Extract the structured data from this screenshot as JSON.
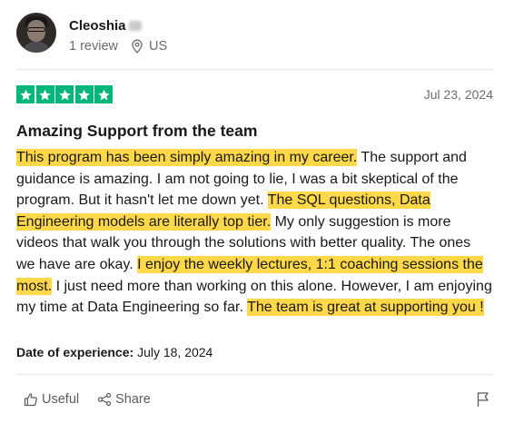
{
  "reviewer": {
    "name": "Cleoshia",
    "reviews_count": "1 review",
    "country": "US"
  },
  "review": {
    "rating": 5,
    "date": "Jul 23, 2024",
    "title": "Amazing Support from the team",
    "segments": [
      {
        "text": "This program has been simply amazing in my career.",
        "highlight": true
      },
      {
        "text": " The support and guidance is amazing. I am not going to lie, I was a bit skeptical of the program. But it hasn't let me down yet. ",
        "highlight": false
      },
      {
        "text": "The SQL questions, Data Engineering models are literally top tier.",
        "highlight": true
      },
      {
        "text": " My only suggestion is more videos that walk you through the solutions with better quality. The ones we have are okay. ",
        "highlight": false
      },
      {
        "text": "I enjoy the weekly lectures, 1:1 coaching sessions the most.",
        "highlight": true
      },
      {
        "text": " I just need more than working on this alone. However, I am enjoying my time at Data Engineering so far. ",
        "highlight": false
      },
      {
        "text": "The team is great at supporting you !",
        "highlight": true
      }
    ],
    "experience_label": "Date of experience:",
    "experience_date": "July 18, 2024"
  },
  "actions": {
    "useful_label": "Useful",
    "share_label": "Share"
  },
  "icons": {
    "location": "location-pin-icon",
    "useful": "thumbs-up-icon",
    "share": "share-icon",
    "flag": "flag-icon",
    "star": "star-icon"
  },
  "colors": {
    "star_green": "#00b67a",
    "highlight": "#ffd84a",
    "muted": "#6b6b6b"
  }
}
